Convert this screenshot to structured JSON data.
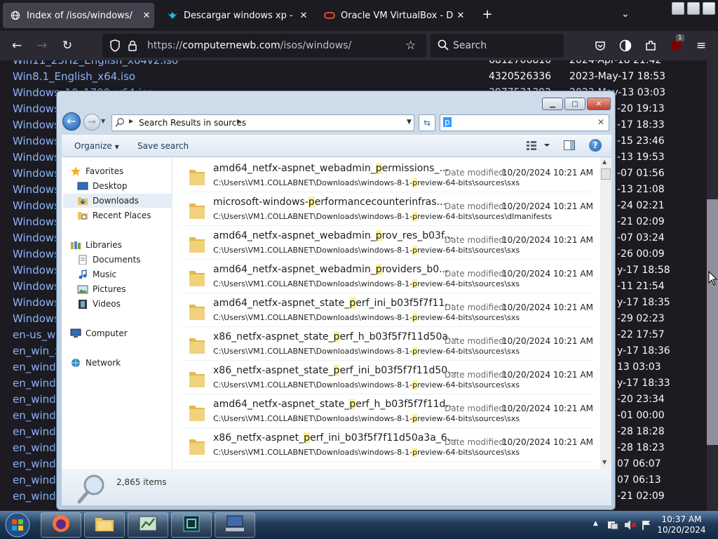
{
  "browser": {
    "tabs": [
      {
        "title": "Index of /isos/windows/",
        "active": true,
        "icon": "globe-icon"
      },
      {
        "title": "Descargar windows xp - Android",
        "active": false,
        "icon": "bird-logo-icon"
      },
      {
        "title": "Oracle VM VirtualBox - Downloads",
        "active": false,
        "icon": "oracle-icon"
      }
    ],
    "new_tab": "+",
    "url_scheme": "https://",
    "url_host": "computernewb.com",
    "url_path": "/isos/windows/",
    "search_placeholder": "Search",
    "extension_badge": "1"
  },
  "listing": [
    {
      "name": "Win11_23H2_English_x64v2.iso",
      "size": "6812706816",
      "date": "2024-Apr-18 21:42"
    },
    {
      "name": "Win8.1_English_x64.iso",
      "size": "4320526336",
      "date": "2023-May-17 18:53"
    },
    {
      "name": "Windows_10_1709_x64.iso",
      "size": "3977531392",
      "date": "2023-May-13 03:03"
    },
    {
      "name": "Windows",
      "size": "",
      "date": "-20 19:13"
    },
    {
      "name": "Windows",
      "size": "",
      "date": "-17 18:33"
    },
    {
      "name": "Windows",
      "size": "",
      "date": "-15 23:46"
    },
    {
      "name": "Windows",
      "size": "",
      "date": "-13 19:53"
    },
    {
      "name": "Windows",
      "size": "",
      "date": "-07 01:56"
    },
    {
      "name": "Windows",
      "size": "",
      "date": "-13 21:08"
    },
    {
      "name": "Windows",
      "size": "",
      "date": "-24 02:21"
    },
    {
      "name": "Windows",
      "size": "",
      "date": "-21 02:09"
    },
    {
      "name": "Windows",
      "size": "",
      "date": "-07 03:24"
    },
    {
      "name": "Windows",
      "size": "",
      "date": "-26 00:09"
    },
    {
      "name": "Windows",
      "size": "",
      "date": "y-17 18:58"
    },
    {
      "name": "Windows",
      "size": "",
      "date": "-11 21:54"
    },
    {
      "name": "Windows",
      "size": "",
      "date": "y-17 18:35"
    },
    {
      "name": "Windows",
      "size": "",
      "date": "-29 02:23"
    },
    {
      "name": "en-us_wi",
      "size": "",
      "date": "-22 17:57"
    },
    {
      "name": "en_win_x",
      "size": "",
      "date": "y-17 18:36"
    },
    {
      "name": "en_windo",
      "size": "",
      "date": "13 03:03"
    },
    {
      "name": "en_windo",
      "size": "",
      "date": "y-17 18:33"
    },
    {
      "name": "en_windo",
      "size": "",
      "date": "-20 23:34"
    },
    {
      "name": "en_windo",
      "size": "",
      "date": "-01 00:00"
    },
    {
      "name": "en_windo",
      "size": "",
      "date": "-28 18:28"
    },
    {
      "name": "en_windo",
      "size": "",
      "date": "-28 18:23"
    },
    {
      "name": "en_windo",
      "size": "",
      "date": "07 06:07"
    },
    {
      "name": "en_windo",
      "size": "",
      "date": "07 06:13"
    },
    {
      "name": "en_windo",
      "size": "",
      "date": "-21 02:09"
    }
  ],
  "explorer": {
    "breadcrumb": "Search Results in sources",
    "search_value": "p",
    "toolbar": {
      "organize": "Organize",
      "save_search": "Save search"
    },
    "nav": {
      "favorites": "Favorites",
      "desktop": "Desktop",
      "downloads": "Downloads",
      "recent": "Recent Places",
      "libraries": "Libraries",
      "documents": "Documents",
      "music": "Music",
      "pictures": "Pictures",
      "videos": "Videos",
      "computer": "Computer",
      "network": "Network"
    },
    "date_label": "Date modified:",
    "files": [
      {
        "pre": "amd64_netfx-aspnet_webadmin_",
        "hl": "p",
        "post": "ermissions_...",
        "path_pre": "C:\\Users\\VM1.COLLABNET\\Downloads\\windows-8-1-",
        "path_hl": "p",
        "path_post": "review-64-bits\\sources\\sxs",
        "date": "10/20/2024 10:21 AM"
      },
      {
        "pre": "microsoft-windows-",
        "hl": "p",
        "post": "erformancecounterinfras...",
        "path_pre": "C:\\Users\\VM1.COLLABNET\\Downloads\\windows-8-1-",
        "path_hl": "p",
        "path_post": "review-64-bits\\sources\\dlmanifests",
        "date": "10/20/2024 10:21 AM"
      },
      {
        "pre": "amd64_netfx-aspnet_webadmin_",
        "hl": "p",
        "post": "rov_res_b03f...",
        "path_pre": "C:\\Users\\VM1.COLLABNET\\Downloads\\windows-8-1-",
        "path_hl": "p",
        "path_post": "review-64-bits\\sources\\sxs",
        "date": "10/20/2024 10:21 AM"
      },
      {
        "pre": "amd64_netfx-aspnet_webadmin_",
        "hl": "p",
        "post": "roviders_b0...",
        "path_pre": "C:\\Users\\VM1.COLLABNET\\Downloads\\windows-8-1-",
        "path_hl": "p",
        "path_post": "review-64-bits\\sources\\sxs",
        "date": "10/20/2024 10:21 AM"
      },
      {
        "pre": "amd64_netfx-aspnet_state_",
        "hl": "p",
        "post": "erf_ini_b03f5f7f11...",
        "path_pre": "C:\\Users\\VM1.COLLABNET\\Downloads\\windows-8-1-",
        "path_hl": "p",
        "path_post": "review-64-bits\\sources\\sxs",
        "date": "10/20/2024 10:21 AM"
      },
      {
        "pre": "x86_netfx-aspnet_state_",
        "hl": "p",
        "post": "erf_h_b03f5f7f11d50a...",
        "path_pre": "C:\\Users\\VM1.COLLABNET\\Downloads\\windows-8-1-",
        "path_hl": "p",
        "path_post": "review-64-bits\\sources\\sxs",
        "date": "10/20/2024 10:21 AM"
      },
      {
        "pre": "x86_netfx-aspnet_state_",
        "hl": "p",
        "post": "erf_ini_b03f5f7f11d50...",
        "path_pre": "C:\\Users\\VM1.COLLABNET\\Downloads\\windows-8-1-",
        "path_hl": "p",
        "path_post": "review-64-bits\\sources\\sxs",
        "date": "10/20/2024 10:21 AM"
      },
      {
        "pre": "amd64_netfx-aspnet_state_",
        "hl": "p",
        "post": "erf_h_b03f5f7f11d...",
        "path_pre": "C:\\Users\\VM1.COLLABNET\\Downloads\\windows-8-1-",
        "path_hl": "p",
        "path_post": "review-64-bits\\sources\\sxs",
        "date": "10/20/2024 10:21 AM"
      },
      {
        "pre": "x86_netfx-aspnet_",
        "hl": "p",
        "post": "erf_ini_b03f5f7f11d50a3a_6...",
        "path_pre": "C:\\Users\\VM1.COLLABNET\\Downloads\\windows-8-1-",
        "path_hl": "p",
        "path_post": "review-64-bits\\sources\\sxs",
        "date": "10/20/2024 10:21 AM"
      }
    ],
    "item_count": "2,865 items"
  },
  "taskbar": {
    "time": "10:37 AM",
    "date": "10/20/2024"
  }
}
